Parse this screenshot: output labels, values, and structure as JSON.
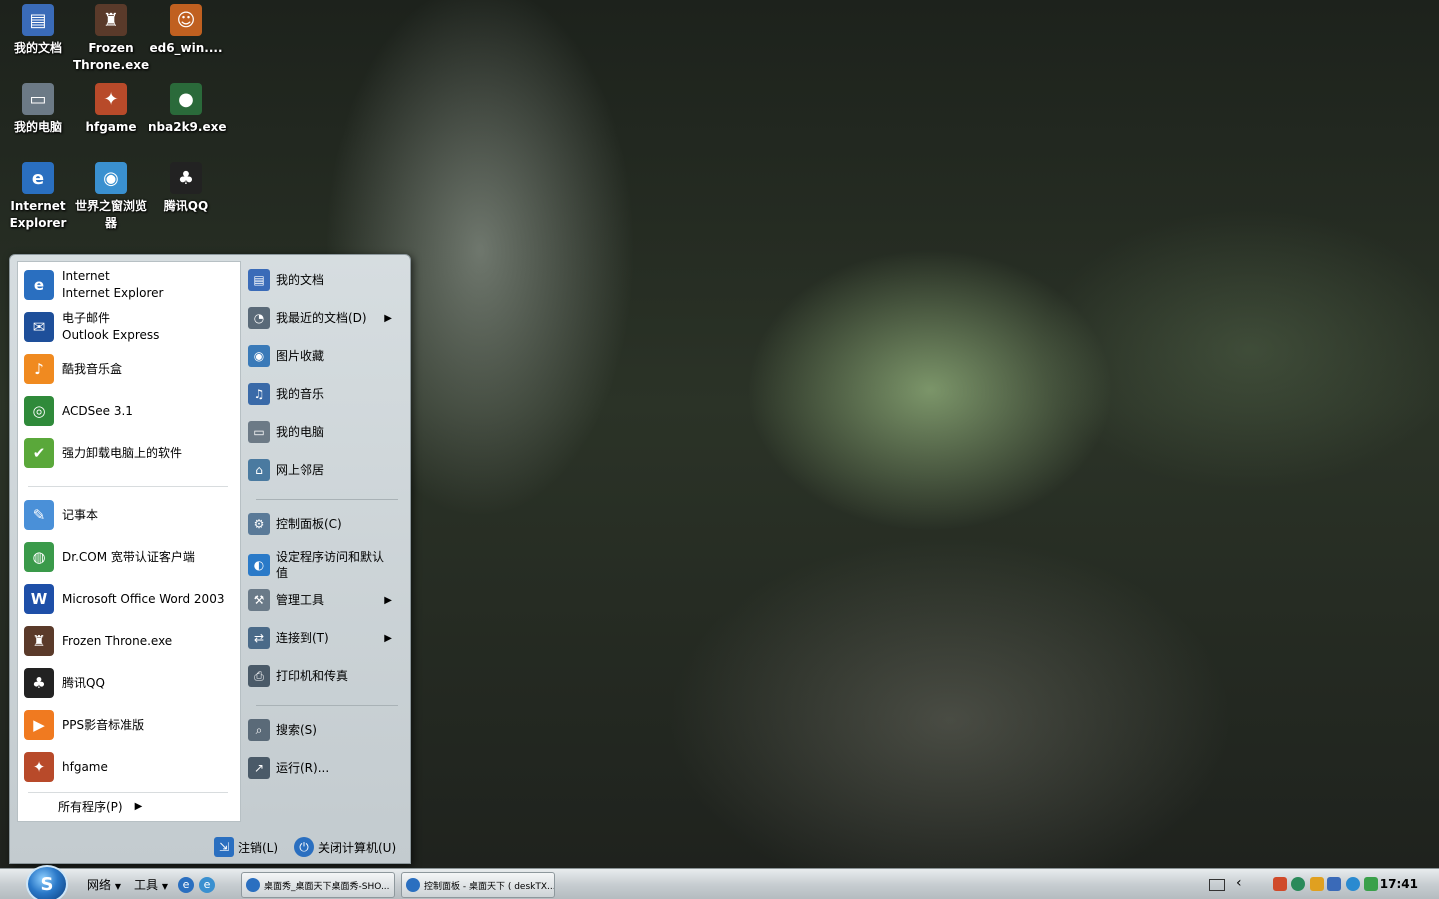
{
  "desktop_icons": [
    {
      "label": "我的文档",
      "icon": "my-documents-icon",
      "color": "#3a6bb8"
    },
    {
      "label": "Frozen Throne.exe",
      "icon": "frozen-throne-icon",
      "color": "#5a3a2a"
    },
    {
      "label": "ed6_win....",
      "icon": "ed6-game-icon",
      "color": "#c06020"
    },
    {
      "label": "我的电脑",
      "icon": "my-computer-icon",
      "color": "#6c7a86"
    },
    {
      "label": "hfgame",
      "icon": "hfgame-icon",
      "color": "#b84a2a"
    },
    {
      "label": "nba2k9.exe",
      "icon": "nba2k9-icon",
      "color": "#2a6a3a"
    },
    {
      "label": "Internet Explorer",
      "icon": "internet-explorer-icon",
      "color": "#2a6fc0"
    },
    {
      "label": "世界之窗浏览器",
      "icon": "theworld-browser-icon",
      "color": "#3a90d0"
    },
    {
      "label": "腾讯QQ",
      "icon": "qq-penguin-icon",
      "color": "#222222"
    }
  ],
  "start_menu": {
    "pinned": [
      {
        "line1": "Internet",
        "line2": "Internet Explorer",
        "icon": "internet-explorer-icon",
        "color": "#2a6fc0"
      },
      {
        "line1": "电子邮件",
        "line2": "Outlook Express",
        "icon": "outlook-express-icon",
        "color": "#1e4f9a"
      }
    ],
    "recent": [
      {
        "label": "酷我音乐盒",
        "icon": "kuwo-music-icon",
        "color": "#f08a20"
      },
      {
        "label": "ACDSee 3.1",
        "icon": "acdsee-icon",
        "color": "#2f8a3a"
      },
      {
        "label": "强力卸载电脑上的软件",
        "icon": "uninstaller-icon",
        "color": "#5aa83a"
      },
      {
        "label": "记事本",
        "icon": "notepad-icon",
        "color": "#4a90d8"
      },
      {
        "label": "Dr.COM 宽带认证客户端",
        "icon": "drcom-icon",
        "color": "#3a9a4a"
      },
      {
        "label": "Microsoft Office Word 2003",
        "icon": "word-icon",
        "color": "#1e4fa8"
      },
      {
        "label": "Frozen Throne.exe",
        "icon": "frozen-throne-icon",
        "color": "#5a3a2a"
      },
      {
        "label": "腾讯QQ",
        "icon": "qq-penguin-icon",
        "color": "#222222"
      },
      {
        "label": "PPS影音标准版",
        "icon": "pps-icon",
        "color": "#f07a20"
      },
      {
        "label": "hfgame",
        "icon": "hfgame-icon",
        "color": "#b84a2a"
      }
    ],
    "all_programs": "所有程序(P)",
    "right": [
      {
        "label": "我的文档",
        "icon": "my-documents-icon",
        "color": "#3a6bb8",
        "arrow": false
      },
      {
        "label": "我最近的文档(D)",
        "icon": "recent-documents-icon",
        "color": "#5a6a78",
        "arrow": true
      },
      {
        "label": "图片收藏",
        "icon": "my-pictures-icon",
        "color": "#3a7ab8",
        "arrow": false
      },
      {
        "label": "我的音乐",
        "icon": "my-music-icon",
        "color": "#3a6aa8",
        "arrow": false
      },
      {
        "label": "我的电脑",
        "icon": "my-computer-icon",
        "color": "#6c7a86",
        "arrow": false
      },
      {
        "label": "网上邻居",
        "icon": "network-places-icon",
        "color": "#4a7aa0",
        "arrow": false
      },
      {
        "label": "控制面板(C)",
        "icon": "control-panel-icon",
        "color": "#5a7a98",
        "arrow": false
      },
      {
        "label": "设定程序访问和默认值",
        "icon": "program-defaults-icon",
        "color": "#2a7ac8",
        "arrow": false
      },
      {
        "label": "管理工具",
        "icon": "admin-tools-icon",
        "color": "#6a7a88",
        "arrow": true
      },
      {
        "label": "连接到(T)",
        "icon": "connect-to-icon",
        "color": "#4a6a88",
        "arrow": true
      },
      {
        "label": "打印机和传真",
        "icon": "printer-icon",
        "color": "#4a5a68",
        "arrow": false
      },
      {
        "label": "搜索(S)",
        "icon": "search-icon",
        "color": "#5a6a78",
        "arrow": false
      },
      {
        "label": "运行(R)...",
        "icon": "run-icon",
        "color": "#4a5a68",
        "arrow": false
      }
    ],
    "logoff": "注销(L)",
    "shutdown": "关闭计算机(U)"
  },
  "taskbar": {
    "network_label": "网络",
    "tools_label": "工具",
    "tasks": [
      {
        "label": "桌面秀_桌面天下桌面秀-SHO..."
      },
      {
        "label": "控制面板 - 桌面天下 ( deskTX..."
      }
    ],
    "clock": "17:41"
  }
}
